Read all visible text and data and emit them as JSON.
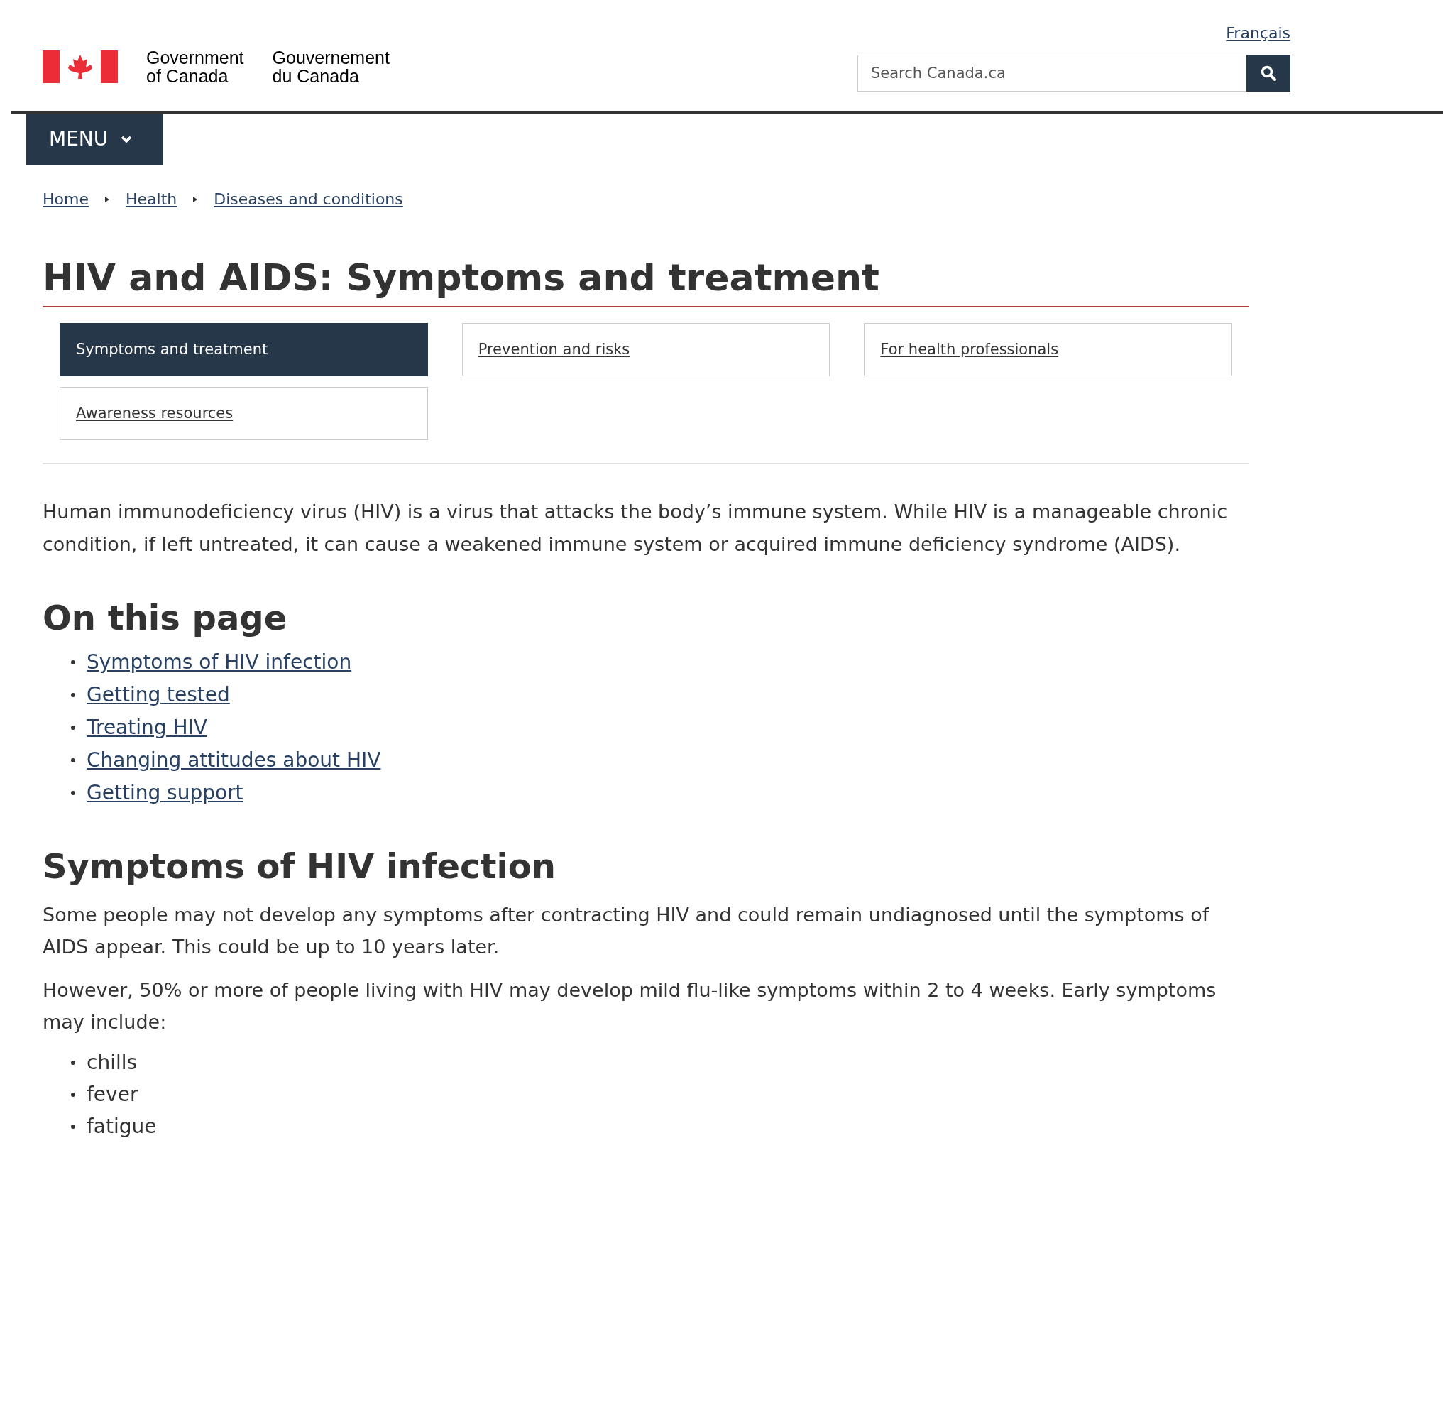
{
  "header": {
    "language_link": "Français",
    "signature_en": [
      "Government",
      "of Canada"
    ],
    "signature_fr": [
      "Gouvernement",
      "du Canada"
    ],
    "search": {
      "placeholder": "Search Canada.ca"
    }
  },
  "menu_button": "MENU",
  "breadcrumbs": [
    "Home",
    "Health",
    "Diseases and conditions"
  ],
  "title": "HIV and AIDS: Symptoms and treatment",
  "tabs": [
    {
      "label": "Symptoms and treatment",
      "selected": true
    },
    {
      "label": "Prevention and risks",
      "selected": false
    },
    {
      "label": "For health professionals",
      "selected": false
    },
    {
      "label": "Awareness resources",
      "selected": false
    }
  ],
  "intro": "Human immunodeficiency virus (HIV) is a virus that attacks the body’s immune system. While HIV is a manageable chronic condition, if left untreated, it can cause a weakened immune system or acquired immune deficiency syndrome (AIDS).",
  "on_this_page": {
    "heading": "On this page",
    "links": [
      "Symptoms of HIV infection",
      "Getting tested",
      "Treating HIV",
      "Changing attitudes about HIV",
      "Getting support"
    ]
  },
  "section": {
    "heading": "Symptoms of HIV infection",
    "paragraphs": [
      "Some people may not develop any symptoms after contracting HIV and could remain undiagnosed until the symptoms of AIDS appear. This could be up to 10 years later.",
      "However, 50% or more of people living with HIV may develop mild flu-like symptoms within 2 to 4 weeks. Early symptoms may include:"
    ],
    "items": [
      "chills",
      "fever",
      "fatigue"
    ]
  }
}
